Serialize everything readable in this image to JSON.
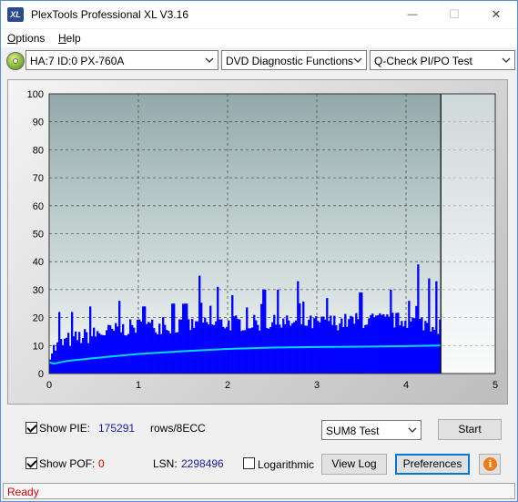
{
  "app": {
    "icon_text": "XL",
    "title": "PlexTools Professional XL V3.16"
  },
  "window_controls": {
    "minimize_glyph": "—",
    "maximize_glyph": "☐",
    "close_glyph": "✕"
  },
  "menu": [
    {
      "label": "Options",
      "accel": "O",
      "rest": "ptions"
    },
    {
      "label": "Help",
      "accel": "H",
      "rest": "elp"
    }
  ],
  "toolbar": {
    "drive": "HA:7 ID:0  PX-760A",
    "function": "DVD Diagnostic Functions",
    "test": "Q-Check PI/PO Test"
  },
  "chart_data": {
    "type": "bar",
    "title": "",
    "xlabel": "",
    "ylabel": "",
    "xlim": [
      0,
      5
    ],
    "ylim": [
      0,
      100
    ],
    "x_ticks": [
      "0",
      "1",
      "2",
      "3",
      "4",
      "5"
    ],
    "y_ticks": [
      "0",
      "10",
      "20",
      "30",
      "40",
      "50",
      "60",
      "70",
      "80",
      "90",
      "100"
    ],
    "grid": true,
    "data_end_x": 4.39,
    "colors": {
      "pie_bars": "#0000ff",
      "pie_envelope": "#00d8ff",
      "plot_bg_top": "#93aaaa",
      "plot_bg_bottom": "#f4f8f8"
    },
    "series": [
      {
        "name": "PIE",
        "envelope_x": [
          0,
          0.2,
          0.5,
          1,
          1.5,
          2,
          2.5,
          3,
          3.5,
          4,
          4.39
        ],
        "envelope_y": [
          8,
          12,
          14,
          17,
          17,
          18,
          18,
          18,
          19,
          19,
          17
        ],
        "spike_x": [
          0.1,
          0.25,
          0.45,
          0.78,
          1.05,
          1.38,
          1.52,
          1.68,
          1.88,
          2.05,
          2.4,
          2.55,
          2.78,
          3.1,
          3.48,
          3.82,
          4.02,
          4.12,
          4.25,
          4.33
        ],
        "spike_y": [
          22,
          22,
          24,
          26,
          24,
          25,
          25,
          35,
          31,
          28,
          30,
          30,
          33,
          27,
          29,
          25,
          26,
          34,
          34,
          33
        ]
      },
      {
        "name": "PIE 8ECC",
        "x": [
          0,
          0.05,
          0.2,
          0.5,
          1,
          1.5,
          2,
          2.5,
          3,
          3.5,
          4,
          4.39
        ],
        "y": [
          4,
          3.5,
          4.5,
          5.5,
          7,
          8,
          8.8,
          9.3,
          9.5,
          9.6,
          9.8,
          10
        ]
      }
    ]
  },
  "controls": {
    "show_pie_label": "Show PIE:",
    "show_pie_checked": true,
    "pie_value": "175291",
    "pie_unit": "rows/8ECC",
    "show_poe_label": "Show POF:",
    "show_poe_checked": true,
    "poe_value": "0",
    "lsn_label": "LSN:",
    "lsn_value": "2298496",
    "logarithmic_label": "Logarithmic",
    "logarithmic_checked": false,
    "mode_select": "SUM8 Test",
    "start_label": "Start",
    "view_log_label": "View Log",
    "preferences_label": "Preferences",
    "info_glyph": "i"
  },
  "status": {
    "text": "Ready"
  }
}
